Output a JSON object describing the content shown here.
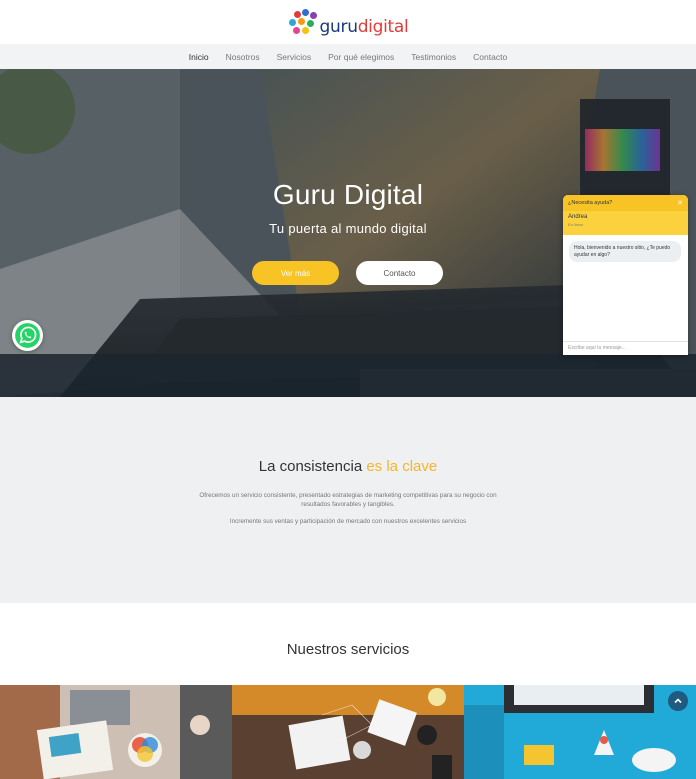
{
  "brand": {
    "logo_text_primary": "guru",
    "logo_text_secondary": "digital"
  },
  "nav": {
    "items": [
      {
        "label": "Inicio",
        "active": true
      },
      {
        "label": "Nosotros",
        "active": false
      },
      {
        "label": "Servicios",
        "active": false
      },
      {
        "label": "Por qué elegimos",
        "active": false
      },
      {
        "label": "Testimonios",
        "active": false
      },
      {
        "label": "Contacto",
        "active": false
      }
    ]
  },
  "hero": {
    "title": "Guru Digital",
    "subtitle": "Tu puerta al mundo digital",
    "primary_button": "Ver más",
    "secondary_button": "Contacto"
  },
  "chat": {
    "header": "¿Necesita ayuda?",
    "agent_name": "Andrea",
    "agent_status": "En línea",
    "message": "Hola, bienvenido a nuestro sitio, ¿Te puedo ayudar en algo?",
    "input_placeholder": "Escribe aquí tu mensaje..."
  },
  "consistency": {
    "title_main": "La consistencia",
    "title_accent": "es la clave",
    "paragraph1": "Ofrecemos un servicio consistente, presentado estrategias de marketing competitivas para su negocio con resultados favorables y tangibles.",
    "paragraph2": "Incremente sus ventas y participación de mercado con nuestros excelentes servicios"
  },
  "services": {
    "title": "Nuestros servicios"
  },
  "icons": [
    "whatsapp-icon",
    "chevron-up-icon",
    "close-icon"
  ],
  "colors": {
    "accent": "#f8c325",
    "accent_text": "#f8b52a",
    "nav_bg": "#f2f3f4",
    "section_bg": "#eef0f2",
    "scroll_button": "#1f5a80"
  }
}
